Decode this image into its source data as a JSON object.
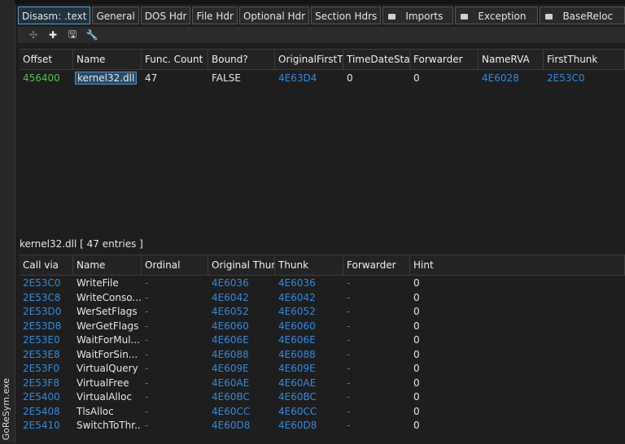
{
  "window": {
    "app_title": "GoReSym.exe"
  },
  "tabs": [
    {
      "label": "Disasm: .text",
      "active": true,
      "has_icon": false
    },
    {
      "label": "General",
      "active": false,
      "has_icon": false
    },
    {
      "label": "DOS Hdr",
      "active": false,
      "has_icon": false
    },
    {
      "label": "File Hdr",
      "active": false,
      "has_icon": false
    },
    {
      "label": "Optional Hdr",
      "active": false,
      "has_icon": false
    },
    {
      "label": "Section Hdrs",
      "active": false,
      "has_icon": false
    },
    {
      "label": "Imports",
      "active": false,
      "has_icon": true
    },
    {
      "label": "Exception",
      "active": false,
      "has_icon": true
    },
    {
      "label": "BaseReloc",
      "active": false,
      "has_icon": true
    }
  ],
  "toolbar": {
    "icons": [
      {
        "name": "move-icon",
        "glyph": "✣",
        "dim": true
      },
      {
        "name": "add-icon",
        "glyph": "✚",
        "dim": false
      },
      {
        "name": "save-icon",
        "glyph": "🖫",
        "dim": false
      },
      {
        "name": "wrench-icon",
        "glyph": "🔧",
        "dim": false
      }
    ]
  },
  "imports_table": {
    "columns": [
      "Offset",
      "Name",
      "Func. Count",
      "Bound?",
      "OriginalFirstT",
      "TimeDateStar",
      "Forwarder",
      "NameRVA",
      "FirstThunk"
    ],
    "rows": [
      {
        "offset": "456400",
        "name": "kernel32.dll",
        "func_count": "47",
        "bound": "FALSE",
        "original_first_thunk": "4E63D4",
        "time_date_stamp": "0",
        "forwarder": "0",
        "name_rva": "4E6028",
        "first_thunk": "2E53C0"
      }
    ]
  },
  "functions_list": {
    "title": "kernel32.dll",
    "entries_label": "[ 47 entries ]",
    "columns": [
      "Call via",
      "Name",
      "Ordinal",
      "Original Thun",
      "Thunk",
      "Forwarder",
      "Hint"
    ],
    "rows": [
      {
        "call_via": "2E53C0",
        "name": "WriteFile",
        "ordinal": "-",
        "original_thunk": "4E6036",
        "thunk": "4E6036",
        "forwarder": "-",
        "hint": "0"
      },
      {
        "call_via": "2E53C8",
        "name": "WriteConso...",
        "ordinal": "-",
        "original_thunk": "4E6042",
        "thunk": "4E6042",
        "forwarder": "-",
        "hint": "0"
      },
      {
        "call_via": "2E53D0",
        "name": "WerSetFlags",
        "ordinal": "-",
        "original_thunk": "4E6052",
        "thunk": "4E6052",
        "forwarder": "-",
        "hint": "0"
      },
      {
        "call_via": "2E53D8",
        "name": "WerGetFlags",
        "ordinal": "-",
        "original_thunk": "4E6060",
        "thunk": "4E6060",
        "forwarder": "-",
        "hint": "0"
      },
      {
        "call_via": "2E53E0",
        "name": "WaitForMul...",
        "ordinal": "-",
        "original_thunk": "4E606E",
        "thunk": "4E606E",
        "forwarder": "-",
        "hint": "0"
      },
      {
        "call_via": "2E53E8",
        "name": "WaitForSin...",
        "ordinal": "-",
        "original_thunk": "4E6088",
        "thunk": "4E6088",
        "forwarder": "-",
        "hint": "0"
      },
      {
        "call_via": "2E53F0",
        "name": "VirtualQuery",
        "ordinal": "-",
        "original_thunk": "4E609E",
        "thunk": "4E609E",
        "forwarder": "-",
        "hint": "0"
      },
      {
        "call_via": "2E53F8",
        "name": "VirtualFree",
        "ordinal": "-",
        "original_thunk": "4E60AE",
        "thunk": "4E60AE",
        "forwarder": "-",
        "hint": "0"
      },
      {
        "call_via": "2E5400",
        "name": "VirtualAlloc",
        "ordinal": "-",
        "original_thunk": "4E60BC",
        "thunk": "4E60BC",
        "forwarder": "-",
        "hint": "0"
      },
      {
        "call_via": "2E5408",
        "name": "TlsAlloc",
        "ordinal": "-",
        "original_thunk": "4E60CC",
        "thunk": "4E60CC",
        "forwarder": "-",
        "hint": "0"
      },
      {
        "call_via": "2E5410",
        "name": "SwitchToThr...",
        "ordinal": "-",
        "original_thunk": "4E60D8",
        "thunk": "4E60D8",
        "forwarder": "-",
        "hint": "0"
      }
    ]
  },
  "colors": {
    "offset_green": "#4cc44c",
    "rva_blue": "#2f8be0",
    "selection": "#2a4a6a"
  }
}
